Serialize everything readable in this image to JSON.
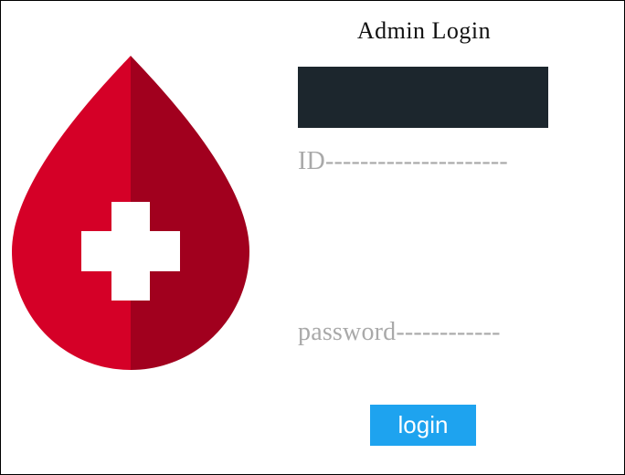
{
  "header": {
    "title": "Admin Login"
  },
  "form": {
    "id_placeholder": "ID---------------------",
    "password_placeholder": "password------------",
    "login_label": "login"
  },
  "colors": {
    "drop_light": "#d50027",
    "drop_dark": "#a1001e",
    "cross": "#ffffff",
    "dark_bar": "#1c262d",
    "button": "#1ea3ef"
  },
  "icons": {
    "logo": "blood-drop-cross-icon"
  }
}
